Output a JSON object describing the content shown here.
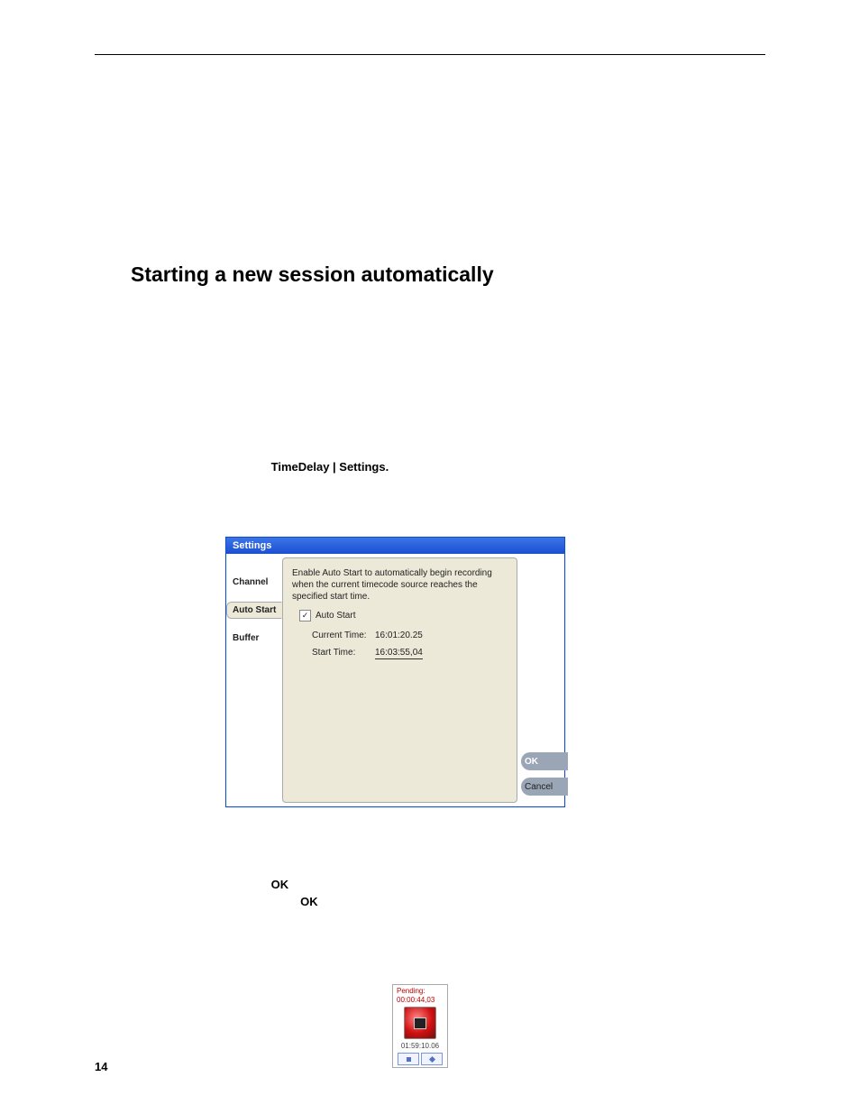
{
  "page": {
    "number": "14",
    "heading": "Starting a new session automatically",
    "menu_path": "TimeDelay | Settings."
  },
  "settings": {
    "title": "Settings",
    "tabs": {
      "channel": "Channel",
      "auto_start": "Auto Start",
      "buffer": "Buffer"
    },
    "description": "Enable Auto Start to automatically begin recording when the current timecode source reaches the specified start time.",
    "checkbox_label": "Auto Start",
    "checkbox_checked": "✓",
    "current_time_label": "Current Time:",
    "current_time_value": "16:01:20.25",
    "start_time_label": "Start Time:",
    "start_time_value": "16:03:55,04",
    "ok_label": "OK",
    "cancel_label": "Cancel"
  },
  "body_text": {
    "ok1": "OK",
    "ok2": "OK"
  },
  "pending": {
    "label": "Pending:",
    "countdown": "00:00:44,03",
    "elapsed": "01:59:10.06"
  }
}
